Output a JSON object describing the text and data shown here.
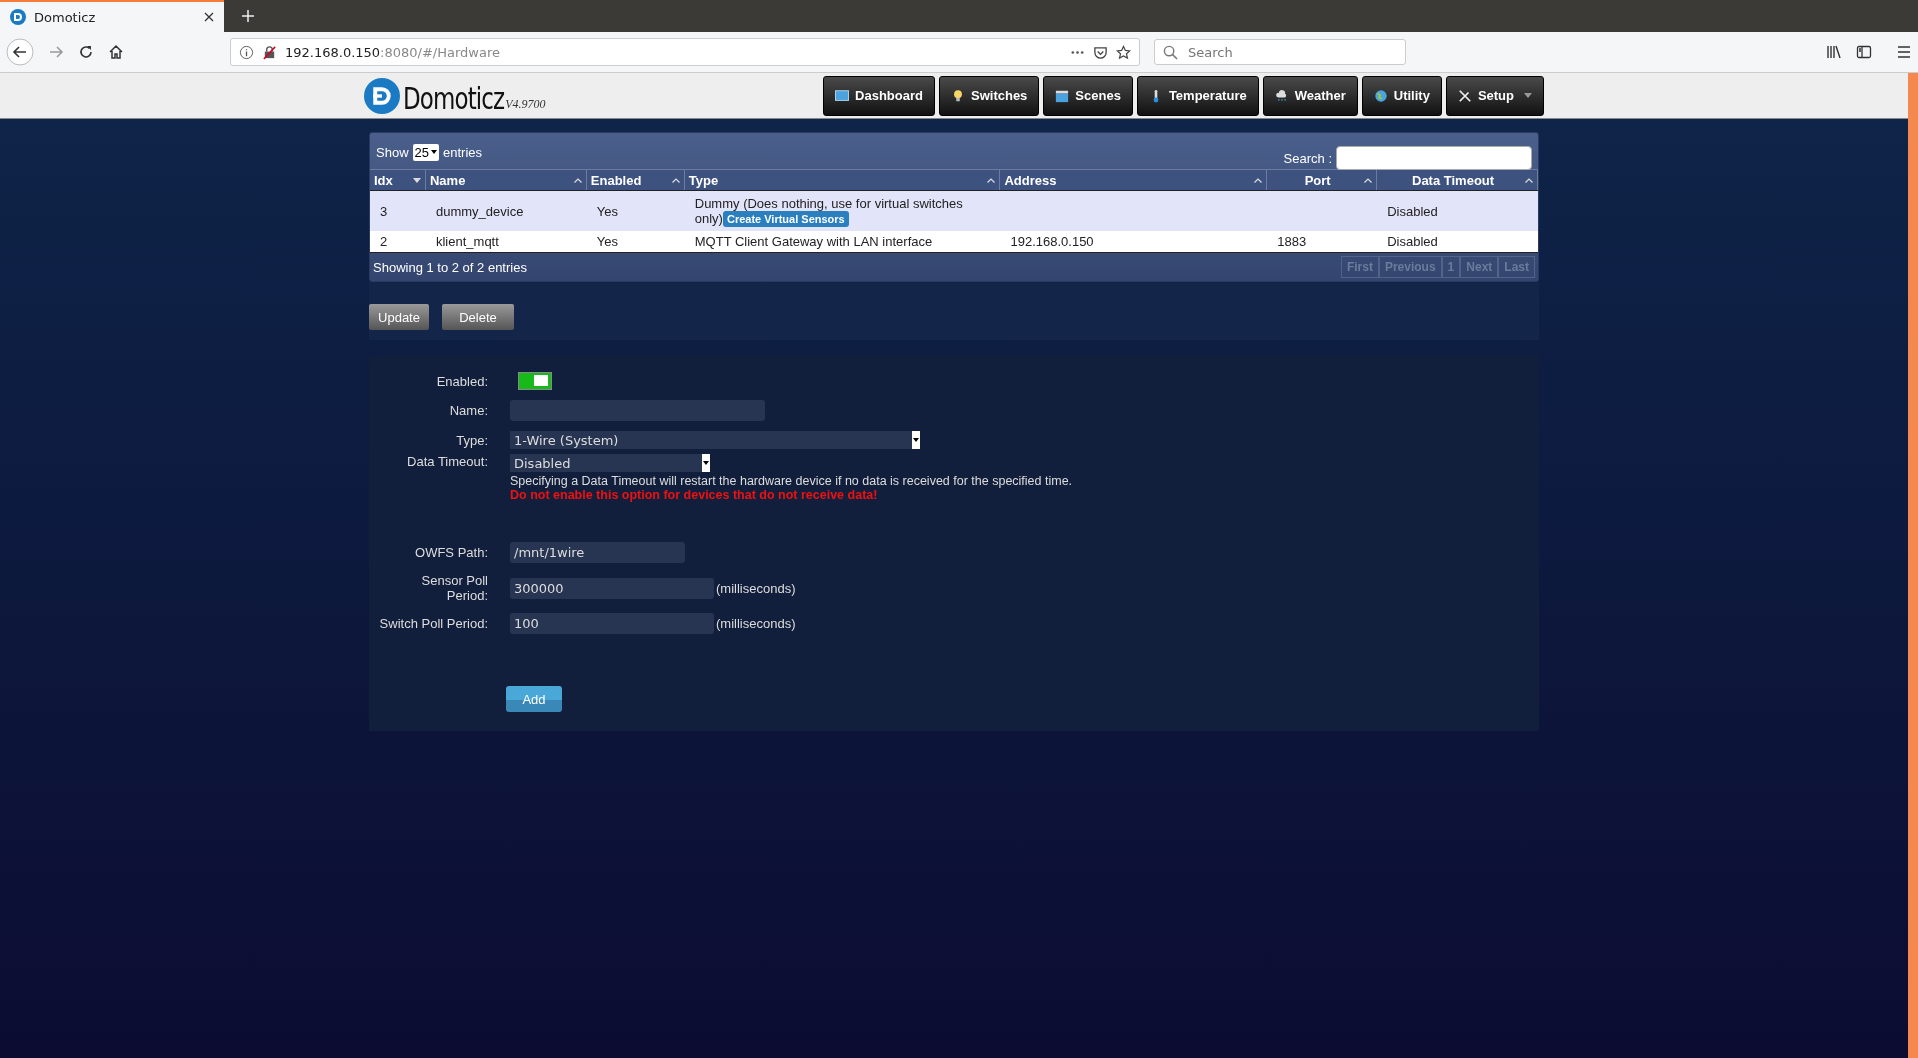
{
  "browser": {
    "tab_title": "Domoticz",
    "url_host": "192.168.0.150",
    "url_rest": ":8080/#/Hardware",
    "search_placeholder": "Search"
  },
  "header": {
    "logo_text": "Domoticz",
    "version": "V4.9700",
    "nav": [
      {
        "label": "Dashboard",
        "dropdown": false
      },
      {
        "label": "Switches",
        "dropdown": false
      },
      {
        "label": "Scenes",
        "dropdown": false
      },
      {
        "label": "Temperature",
        "dropdown": false
      },
      {
        "label": "Weather",
        "dropdown": false
      },
      {
        "label": "Utility",
        "dropdown": false
      },
      {
        "label": "Setup",
        "dropdown": true
      }
    ]
  },
  "hardware_table": {
    "show_label": "Show",
    "page_size": "25",
    "entries_label": "entries",
    "search_label": "Search :",
    "columns": [
      {
        "label": "Idx",
        "sorted": true
      },
      {
        "label": "Name",
        "sorted": false
      },
      {
        "label": "Enabled",
        "sorted": false
      },
      {
        "label": "Type",
        "sorted": false
      },
      {
        "label": "Address",
        "sorted": false
      },
      {
        "label": "Port",
        "sorted": false
      },
      {
        "label": "Data Timeout",
        "sorted": false
      }
    ],
    "rows": [
      {
        "selected": true,
        "idx": "3",
        "name": "dummy_device",
        "enabled": "Yes",
        "type": "Dummy (Does nothing, use for virtual switches only)",
        "action": "Create Virtual Sensors",
        "data_timeout": "Disabled"
      },
      {
        "selected": false,
        "idx": "2",
        "name": "klient_mqtt",
        "enabled": "Yes",
        "type": "MQTT Client Gateway with LAN interface",
        "address": "192.168.0.150",
        "port": "1883",
        "data_timeout": "Disabled"
      }
    ],
    "info": "Showing 1 to 2 of 2 entries",
    "pagination": [
      {
        "label": "First",
        "disabled": true
      },
      {
        "label": "Previous",
        "disabled": true
      },
      {
        "label": "1",
        "disabled": true
      },
      {
        "label": "Next",
        "disabled": true
      },
      {
        "label": "Last",
        "disabled": true
      }
    ]
  },
  "actions": [
    "Update",
    "Delete"
  ],
  "form": {
    "enabled": {
      "label": "Enabled:",
      "on": true
    },
    "name": {
      "label": "Name:"
    },
    "type": {
      "label": "Type:",
      "value": "1-Wire (System)"
    },
    "data_timeout": {
      "label": "Data Timeout:",
      "value": "Disabled",
      "hint": "Specifying a Data Timeout will restart the hardware device if no data is received for the specified time.",
      "warning": "Do not enable this option for devices that do not receive data!"
    },
    "owfs_path": {
      "label": "OWFS Path:",
      "value": "/mnt/1wire"
    },
    "sensor_poll": {
      "label": "Sensor Poll Period:",
      "value": "300000",
      "unit": "(milliseconds)"
    },
    "switch_poll": {
      "label": "Switch Poll Period:",
      "value": "100",
      "unit": "(milliseconds)"
    },
    "submit": "Add"
  }
}
